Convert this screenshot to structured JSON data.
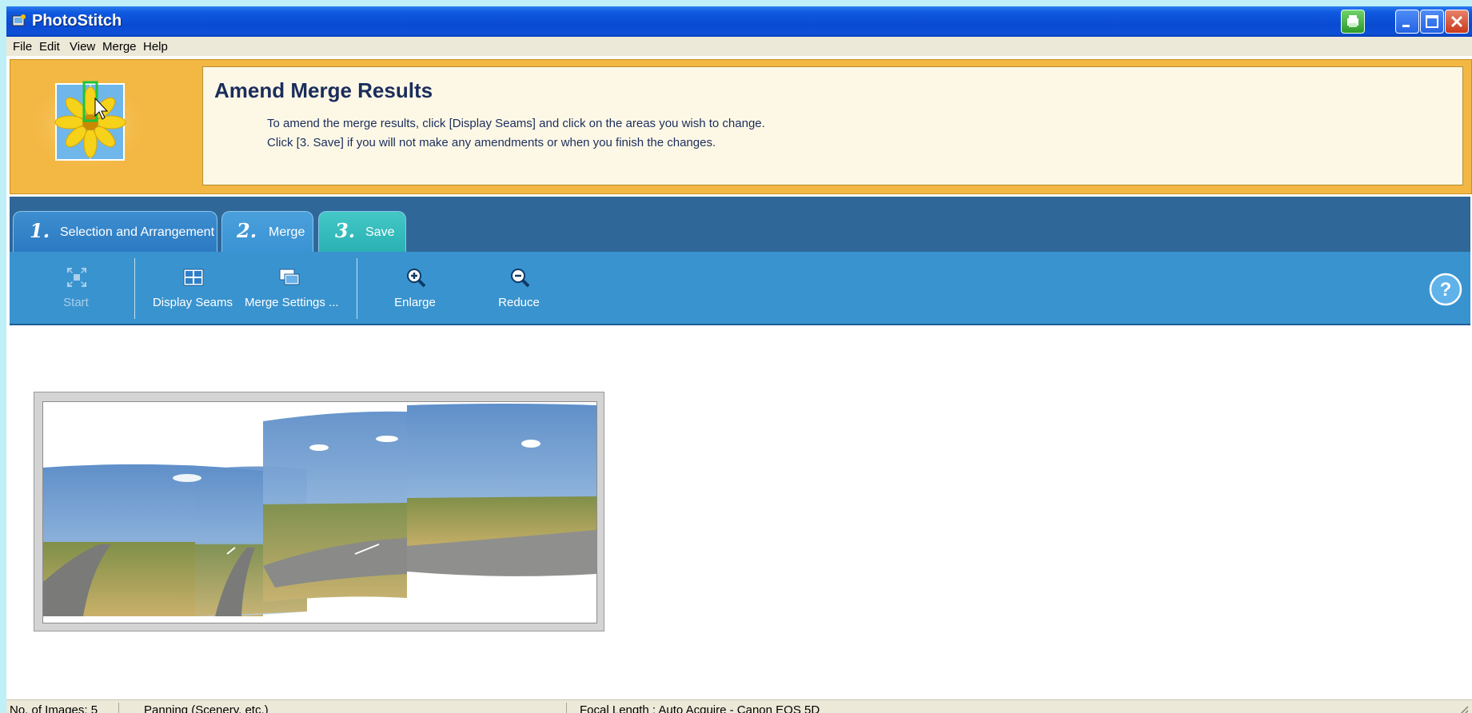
{
  "window": {
    "title": "PhotoStitch"
  },
  "menu": [
    "File",
    "Edit",
    "View",
    "Merge",
    "Help"
  ],
  "banner": {
    "title": "Amend Merge Results",
    "line1": "To amend the merge results, click [Display Seams] and click on the areas you wish to change.",
    "line2": "Click [3. Save] if you will not make any amendments or when you finish the changes."
  },
  "tabs": [
    {
      "num": "1.",
      "label": "Selection and Arrangement"
    },
    {
      "num": "2.",
      "label": "Merge",
      "active": true
    },
    {
      "num": "3.",
      "label": "Save"
    }
  ],
  "toolbar": {
    "start": "Start",
    "display_seams": "Display Seams",
    "merge_settings": "Merge Settings ...",
    "enlarge": "Enlarge",
    "reduce": "Reduce"
  },
  "icons": {
    "start": "merge-start-icon",
    "display_seams": "seams-grid-icon",
    "merge_settings": "stacked-images-icon",
    "enlarge": "zoom-in-icon",
    "reduce": "zoom-out-icon",
    "help": "help-icon"
  },
  "status": {
    "images": "No. of Images: 5",
    "mode": "Panning (Scenery, etc.)",
    "focal": "Focal Length : Auto Acquire - Canon EOS 5D"
  },
  "colors": {
    "titlebar": "#0a4bd2",
    "banner": "#f3b844",
    "tabstrip": "#2f6798",
    "toolbar": "#3993cf",
    "save_tab": "#2bb1b4"
  }
}
